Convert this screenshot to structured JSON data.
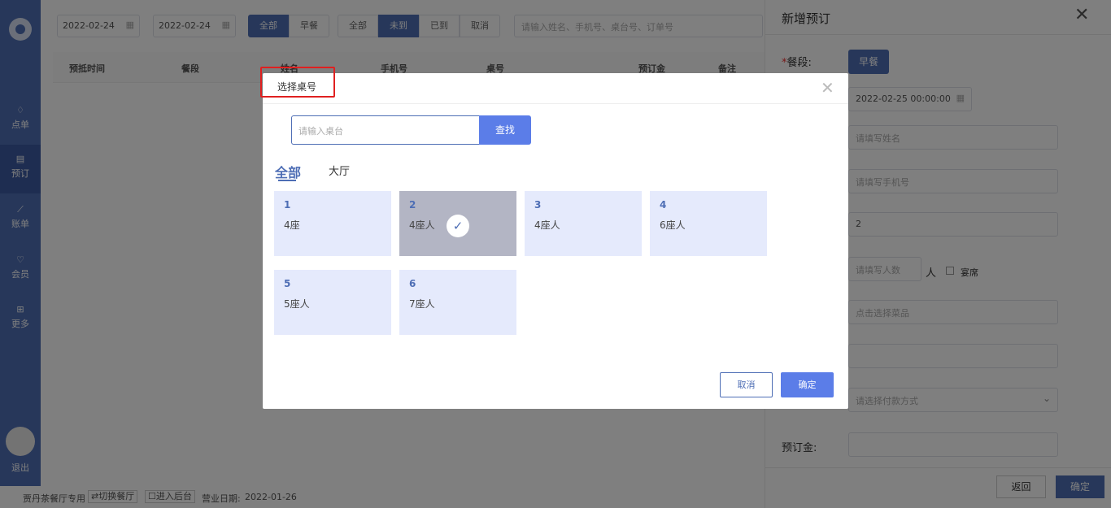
{
  "sidebar": {
    "items": [
      {
        "label": "点单",
        "icon": "diamond-icon"
      },
      {
        "label": "预订",
        "icon": "book-icon"
      },
      {
        "label": "账单",
        "icon": "chart-icon"
      },
      {
        "label": "会员",
        "icon": "gem-icon"
      },
      {
        "label": "更多",
        "icon": "grid-icon"
      }
    ],
    "quit": "退出"
  },
  "toolbar": {
    "date_from": "2022-02-24",
    "date_to": "2022-02-24",
    "tilde": "~",
    "meal_filters": [
      "全部",
      "早餐"
    ],
    "status_filters": [
      "全部",
      "未到",
      "已到",
      "取消"
    ],
    "search_placeholder": "请输入姓名、手机号、桌台号、订单号"
  },
  "table": {
    "headers": [
      "预抵时间",
      "餐段",
      "姓名",
      "手机号",
      "桌号",
      "预订金",
      "备注"
    ]
  },
  "footer": {
    "shop": "贾丹茶餐厅专用",
    "switch": "⇄切换餐厅",
    "backend": "☐进入后台",
    "business_date_label": "营业日期:",
    "business_date": "2022-01-26"
  },
  "panel": {
    "title": "新增预订",
    "meal_label": "餐段:",
    "meal_value": "早餐",
    "datetime": "2022-02-25 00:00:00",
    "name_placeholder": "请填写姓名",
    "phone_placeholder": "请填写手机号",
    "table_value": "2",
    "people_placeholder": "请填写人数",
    "people_unit": "人",
    "banquet_label": "宴席",
    "dishes_placeholder": "点击选择菜品",
    "payment_placeholder": "请选择付款方式",
    "deposit_label": "预订金:",
    "back": "返回",
    "confirm": "确定"
  },
  "modal": {
    "title": "选择桌号",
    "search_placeholder": "请输入桌台",
    "search_button": "查找",
    "tabs": [
      "全部",
      "大厅"
    ],
    "tables": [
      {
        "num": "1",
        "seats": "4座",
        "selected": false
      },
      {
        "num": "2",
        "seats": "4座人",
        "selected": true
      },
      {
        "num": "3",
        "seats": "4座人",
        "selected": false
      },
      {
        "num": "4",
        "seats": "6座人",
        "selected": false
      },
      {
        "num": "5",
        "seats": "5座人",
        "selected": false
      },
      {
        "num": "6",
        "seats": "7座人",
        "selected": false
      }
    ],
    "cancel": "取消",
    "confirm": "确定"
  },
  "colors": {
    "accent": "#4e6eb5",
    "button": "#5b7de8",
    "card": "#e5eafc",
    "card_selected": "#b3b5c4",
    "highlight": "#e02020"
  }
}
